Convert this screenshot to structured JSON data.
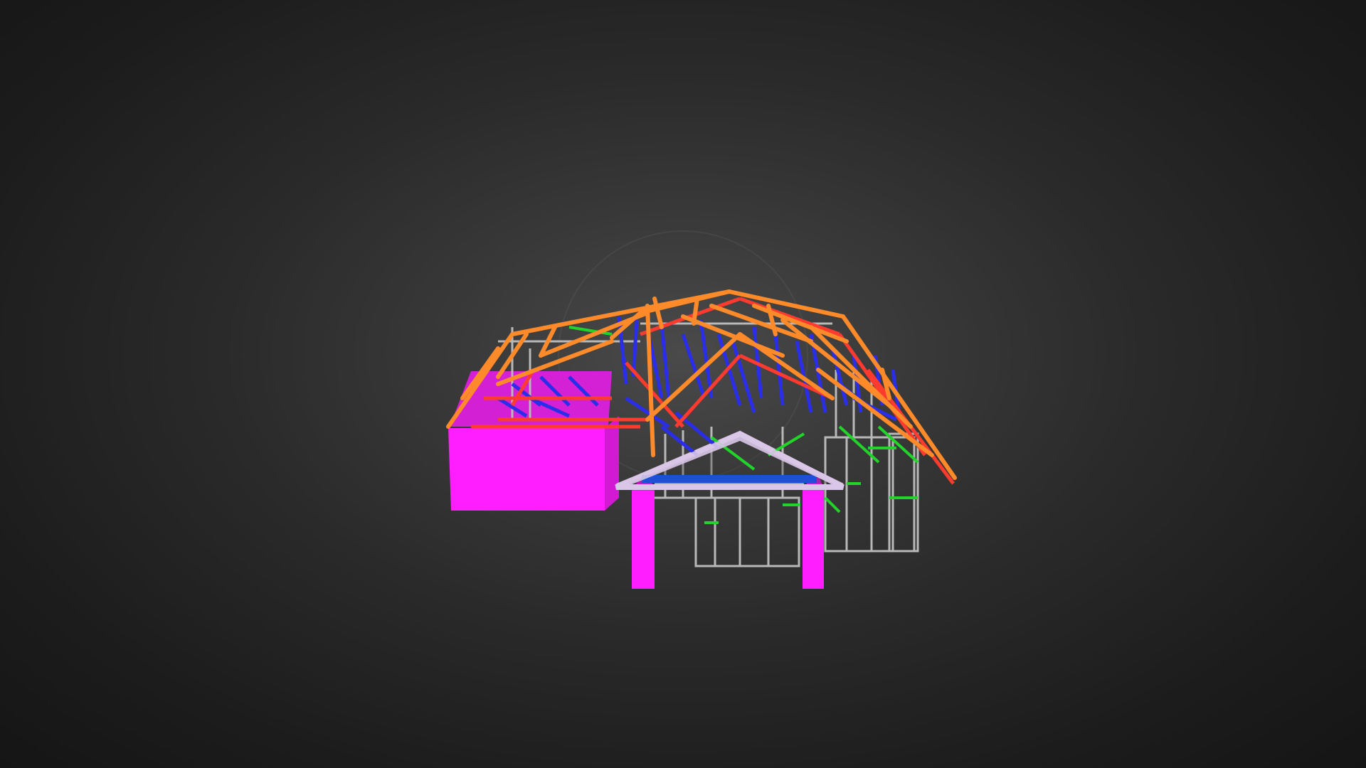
{
  "viewer": {
    "background_center": "#4a4a4a",
    "background_edge": "#151515"
  },
  "model": {
    "subject": "steel-frame-house-3d-model",
    "colors": {
      "wall_panel": "#ff1eff",
      "roof_rafter": "#ff8a2a",
      "roof_ridge": "#ff3b2f",
      "truss_web": "#2a2ee8",
      "bracing": "#22d42a",
      "wall_frame": "#b8b8b8",
      "lintel_beam": "#1e4fd8",
      "gable_trim": "#d9c6e8"
    }
  }
}
